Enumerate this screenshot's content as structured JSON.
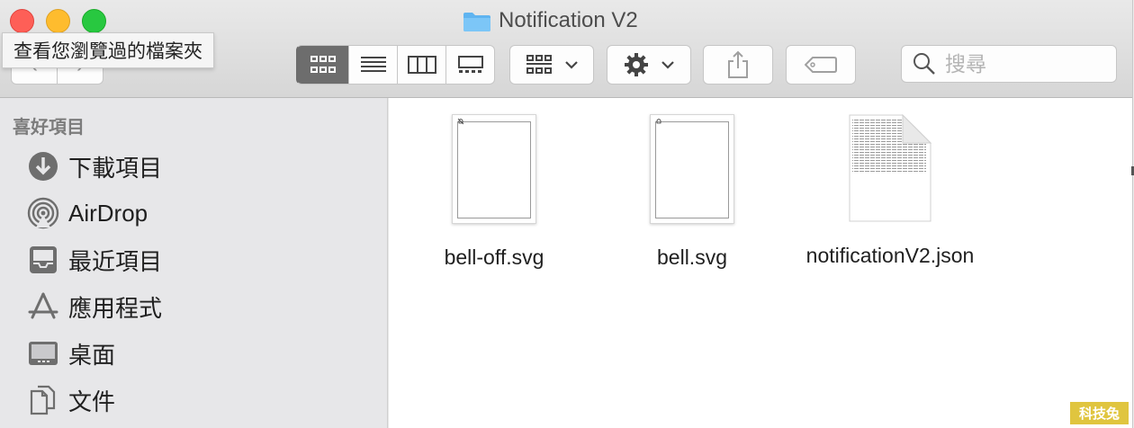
{
  "window": {
    "title": "Notification V2",
    "tooltip": "查看您瀏覽過的檔案夾"
  },
  "toolbar": {
    "back_glyph": "‹",
    "forward_glyph": "›",
    "view_modes": [
      "icon-view",
      "list-view",
      "column-view",
      "gallery-view"
    ],
    "active_view": "icon-view",
    "search_placeholder": "搜尋"
  },
  "sidebar": {
    "header": "喜好項目",
    "items": [
      {
        "label": "下載項目",
        "icon": "download-icon"
      },
      {
        "label": "AirDrop",
        "icon": "airdrop-icon"
      },
      {
        "label": "最近項目",
        "icon": "recents-icon"
      },
      {
        "label": "應用程式",
        "icon": "applications-icon"
      },
      {
        "label": "桌面",
        "icon": "desktop-icon"
      },
      {
        "label": "文件",
        "icon": "documents-icon"
      }
    ]
  },
  "files": [
    {
      "name": "bell-off.svg",
      "type": "svg"
    },
    {
      "name": "bell.svg",
      "type": "svg"
    },
    {
      "name": "notificationV2.json",
      "type": "json"
    }
  ],
  "watermark": "科技兔",
  "colors": {
    "close": "#fe5f57",
    "minimize": "#febc2e",
    "maximize": "#28c840",
    "folder": "#5fb4f0",
    "active_view": "#6d6d6d"
  }
}
